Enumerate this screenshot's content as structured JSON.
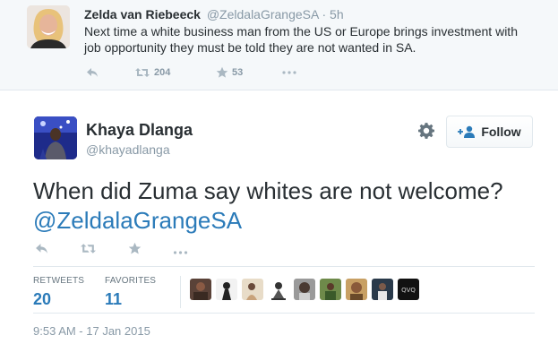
{
  "parent_tweet": {
    "name": "Zelda van Riebeeck",
    "handle": "@ZeldalaGrangeSA",
    "separator": "·",
    "time": "5h",
    "text": "Next time a white business man from the US or Europe brings investment with job opportunity they must be told they are not wanted in SA.",
    "retweet_count": "204",
    "favorite_count": "53",
    "icons": [
      "reply-icon",
      "retweet-icon",
      "favorite-icon",
      "more-icon"
    ]
  },
  "tweet": {
    "author_name": "Khaya Dlanga",
    "author_handle": "@khayadlanga",
    "follow_label": "Follow",
    "text_before_mention": "When did Zuma say whites are not welcome? ",
    "mention": "@ZeldalaGrangeSA",
    "retweets_label": "RETWEETS",
    "retweets_count": "20",
    "favorites_label": "FAVORITES",
    "favorites_count": "11",
    "favoriter_avatar_count": 9,
    "timestamp": "9:53 AM - 17 Jan 2015",
    "icons": [
      "gear-icon",
      "follow-person-icon",
      "reply-icon",
      "retweet-icon",
      "favorite-icon",
      "more-icon"
    ]
  },
  "colors": {
    "link": "#2b7bb9",
    "text": "#292f33",
    "muted": "#8899a6",
    "icon": "#aab8c2",
    "parent_bg": "#f5f8fa",
    "border": "#e1e8ed"
  }
}
